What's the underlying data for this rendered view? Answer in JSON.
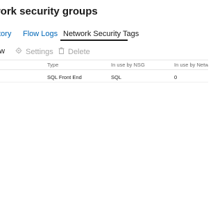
{
  "page": {
    "title": "work security groups"
  },
  "tabs": [
    {
      "label": "tory",
      "active": false
    },
    {
      "label": "Flow Logs",
      "active": false
    },
    {
      "label": "Network Security Tags",
      "active": true
    }
  ],
  "toolbar": {
    "new_label": "w",
    "settings_label": "Settings",
    "delete_label": "Delete"
  },
  "table": {
    "columns": [
      "Type",
      "In use by NSG",
      "In use by Netwo"
    ],
    "rows": [
      {
        "type": "SQL Front End",
        "in_use_by_nsg": "SQL",
        "in_use_by_network": "0"
      }
    ]
  },
  "icons": {
    "settings": "gear-icon",
    "delete": "trash-icon"
  },
  "colors": {
    "link": "#0067b8",
    "disabled": "#a6a6a6",
    "text": "#1a1a1a"
  }
}
